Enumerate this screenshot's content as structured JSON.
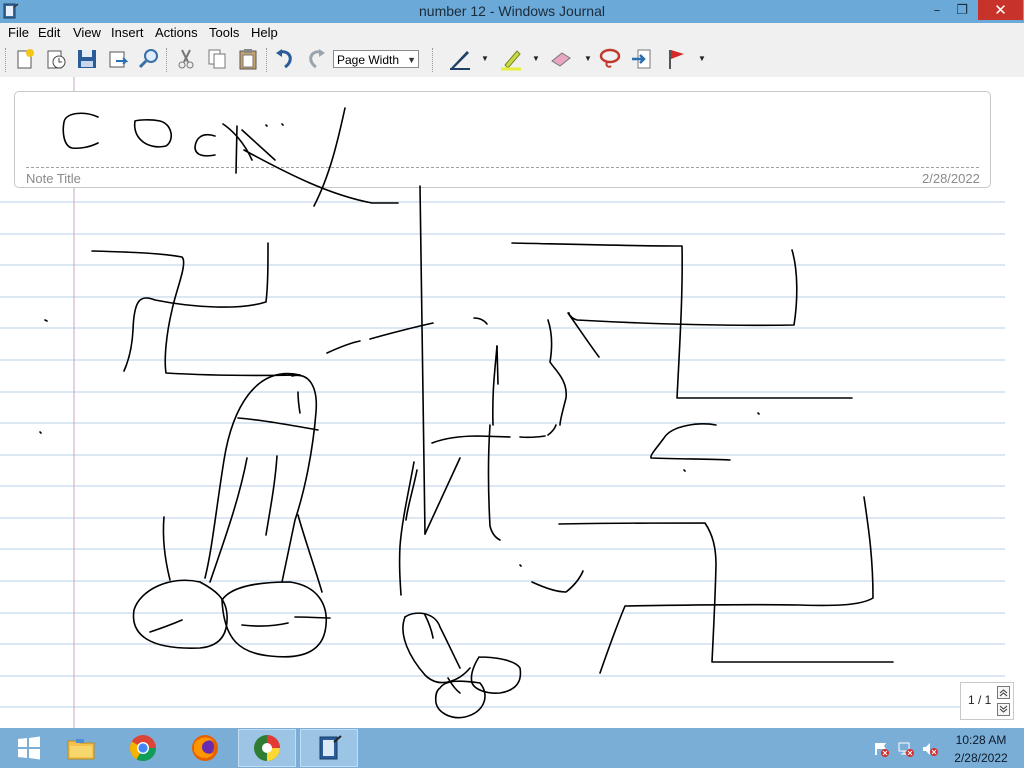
{
  "window": {
    "title": "number 12 - Windows Journal"
  },
  "caption_buttons": {
    "minimize": "–",
    "maximize": "❐",
    "close": "✕"
  },
  "menu": [
    "File",
    "Edit",
    "View",
    "Insert",
    "Actions",
    "Tools",
    "Help"
  ],
  "toolbar": {
    "zoom": {
      "selected": "Page Width"
    },
    "buttons": [
      "new-note-icon",
      "open-recent-icon",
      "save-icon",
      "email-icon",
      "find-icon",
      "cut-icon",
      "copy-icon",
      "paste-icon",
      "undo-icon",
      "redo-icon",
      "pen-icon",
      "highlighter-icon",
      "eraser-icon",
      "lasso-select-icon",
      "insert-space-icon",
      "flag-icon"
    ]
  },
  "note": {
    "title_placeholder": "Note Title",
    "date": "2/28/2022"
  },
  "pager": {
    "indicator": "1 / 1"
  },
  "taskbar": {
    "apps": [
      "windows-start-icon",
      "file-explorer-icon",
      "chrome-icon",
      "firefox-icon",
      "app-icon",
      "windows-journal-icon"
    ],
    "time": "10:28 AM",
    "date": "2/28/2022"
  },
  "colors": {
    "titlebar": "#6aa9d8",
    "close": "#c7322a",
    "taskbar": "#7baed6",
    "ruled_line": "#b9cfe8",
    "margin_line": "#c9a3c9"
  }
}
